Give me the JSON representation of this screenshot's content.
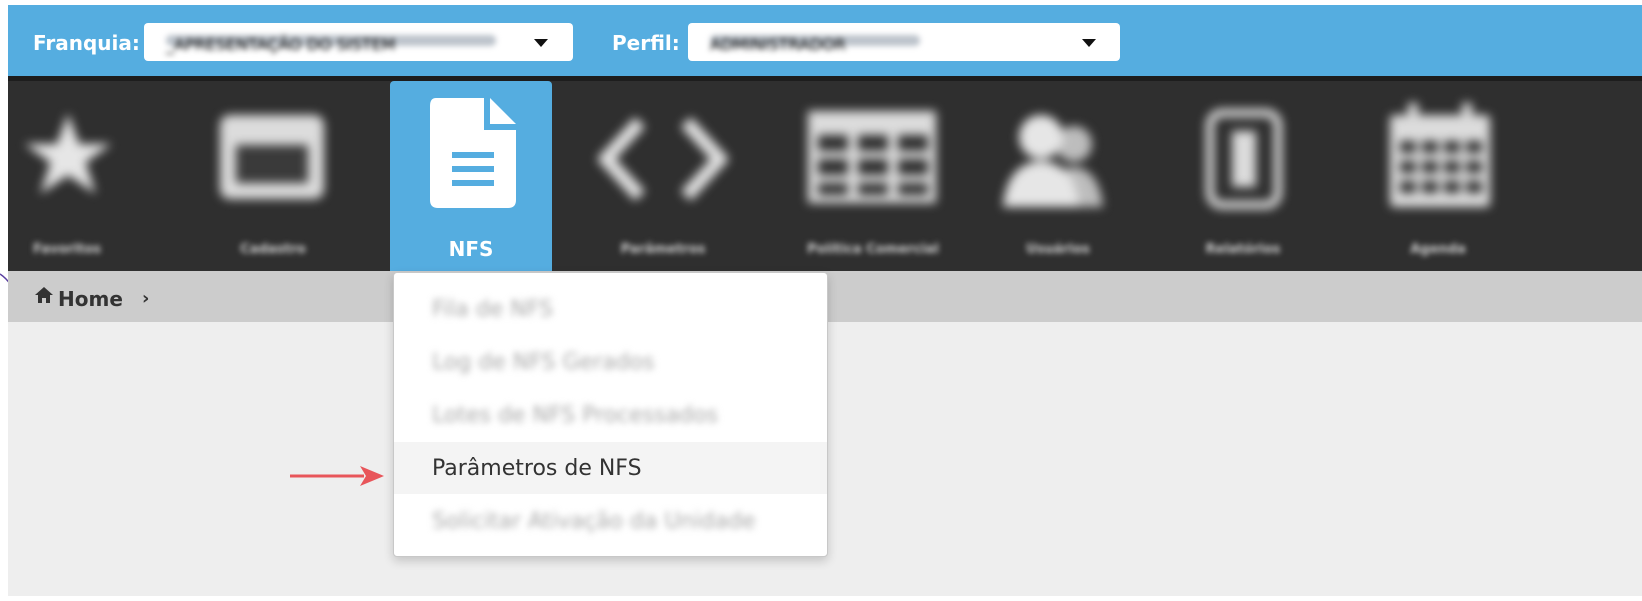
{
  "topbar": {
    "franquia_label": "Franquia:",
    "franquia_value": "_APRESENTAÇÃO DO SISTEM",
    "perfil_label": "Perfil:",
    "perfil_value": "ADMINISTRADOR"
  },
  "nav": {
    "items": [
      {
        "label": "Favoritos",
        "icon": "star-icon"
      },
      {
        "label": "Cadastro",
        "icon": "window-icon"
      },
      {
        "label": "NFS",
        "icon": "document-icon"
      },
      {
        "label": "Parâmetros",
        "icon": "code-icon"
      },
      {
        "label": "Política Comercial",
        "icon": "table-icon"
      },
      {
        "label": "Usuários",
        "icon": "users-icon"
      },
      {
        "label": "Relatórios",
        "icon": "report-icon"
      },
      {
        "label": "Agenda",
        "icon": "calendar-icon"
      }
    ],
    "active": "NFS"
  },
  "breadcrumb": {
    "home": "Home",
    "separator": "›"
  },
  "dropdown": {
    "items": [
      {
        "label": "Fila de NFS",
        "highlighted": false
      },
      {
        "label": "Log de NFS Gerados",
        "highlighted": false
      },
      {
        "label": "Lotes de NFS Processados",
        "highlighted": false
      },
      {
        "label": "Parâmetros de NFS",
        "highlighted": true
      },
      {
        "label": "Solicitar Ativação da Unidade",
        "highlighted": false
      }
    ]
  },
  "colors": {
    "topbar": "#55ade0",
    "navbar": "#2f2f2f",
    "breadcrumb": "#cccccc",
    "arrow": "#e8555a"
  }
}
